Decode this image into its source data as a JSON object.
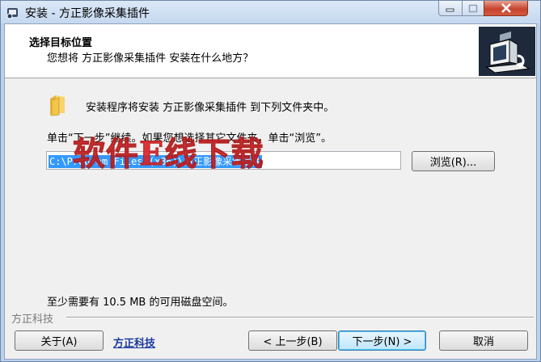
{
  "window": {
    "title": "安装 - 方正影像采集插件"
  },
  "header": {
    "title": "选择目标位置",
    "subtitle": "您想将 方正影像采集插件 安装在什么地方？"
  },
  "body": {
    "info": "安装程序将安装 方正影像采集插件 到下列文件夹中。",
    "hint": "单击“下一步”继续。如果您想选择其它文件夹，单击“浏览”。",
    "path_value": "C:\\Program Files (x86)\\方正影像采集插件",
    "watermark": "软件E线下载",
    "browse_label": "浏览(R)...",
    "space_required": "至少需要有 10.5 MB 的可用磁盘空间。"
  },
  "footer": {
    "brand_label": "方正科技",
    "about_label": "关于(A)",
    "brand_link": "方正科技",
    "back_label": "< 上一步(B)",
    "next_label": "下一步(N) >",
    "cancel_label": "取消"
  },
  "colors": {
    "selection": "#3399ff",
    "watermark": "#d8242a",
    "link": "#1a3a9e"
  }
}
